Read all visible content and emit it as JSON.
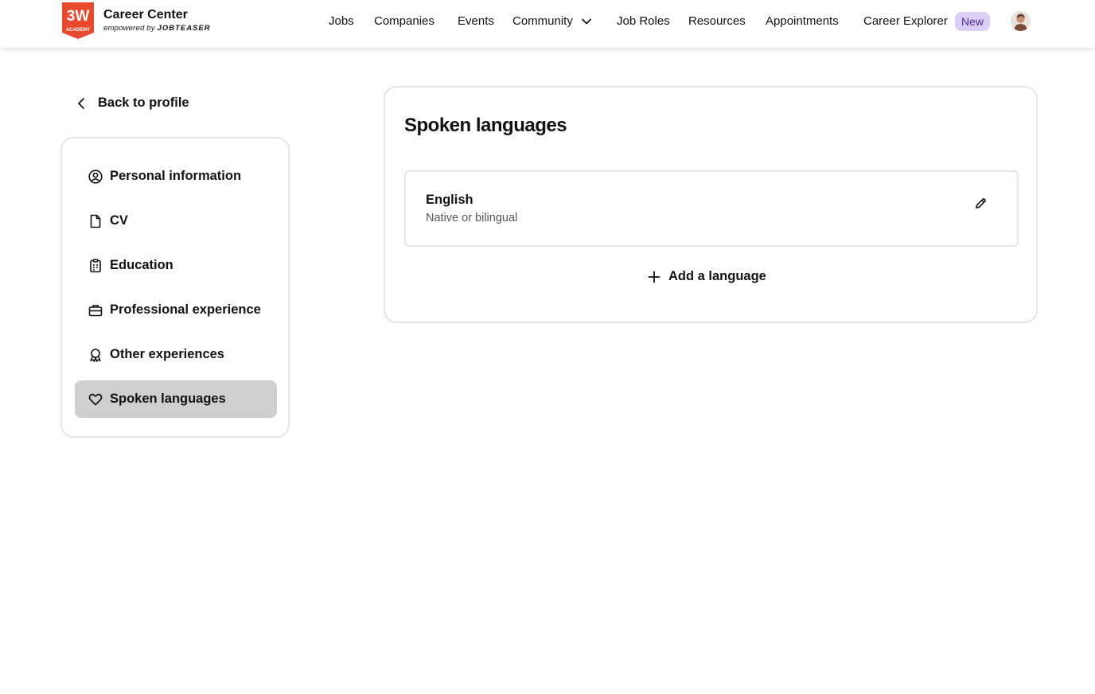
{
  "header": {
    "brand_title": "Career Center",
    "brand_sub_prefix": "empowered by",
    "brand_sub_name": "JOBTEASER",
    "logo_text_top": "3W",
    "logo_text_bottom": "ACADEMY",
    "logo_color": "#e84a2f",
    "nav": [
      {
        "label": "Jobs"
      },
      {
        "label": "Companies"
      },
      {
        "label": "Events"
      },
      {
        "label": "Community"
      },
      {
        "label": "Job Roles"
      },
      {
        "label": "Resources"
      },
      {
        "label": "Appointments"
      },
      {
        "label": "Career Explorer"
      }
    ],
    "new_badge": "New"
  },
  "sidebar": {
    "back_label": "Back to profile",
    "items": [
      {
        "label": "Personal information",
        "icon": "user-circle-icon"
      },
      {
        "label": "CV",
        "icon": "file-icon"
      },
      {
        "label": "Education",
        "icon": "clipboard-icon"
      },
      {
        "label": "Professional experience",
        "icon": "briefcase-icon"
      },
      {
        "label": "Other experiences",
        "icon": "award-icon"
      },
      {
        "label": "Spoken languages",
        "icon": "heart-icon",
        "active": true
      }
    ]
  },
  "main": {
    "title": "Spoken languages",
    "languages": [
      {
        "name": "English",
        "level": "Native or bilingual"
      }
    ],
    "add_label": "Add a language"
  },
  "colors": {
    "active_bg": "#cfcfcf",
    "badge_bg": "#dccff7",
    "badge_text": "#4b2a99",
    "border": "#e6e6e6"
  }
}
